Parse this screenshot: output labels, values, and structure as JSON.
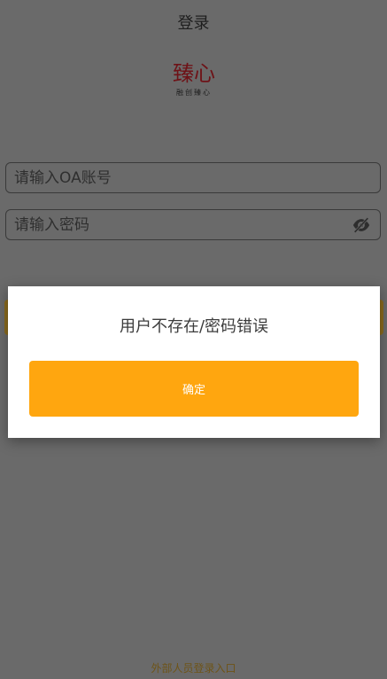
{
  "header": {
    "title": "登录"
  },
  "logo": {
    "main_text": "臻心",
    "sub_text": "融创臻心"
  },
  "form": {
    "account_placeholder": "请输入OA账号",
    "password_placeholder": "请输入密码",
    "password_toggle_icon": "eye-slash-icon"
  },
  "footer": {
    "external_login_label": "外部人员登录入口"
  },
  "dialog": {
    "message": "用户不存在/密码错误",
    "confirm_label": "确定"
  },
  "colors": {
    "accent": "#ffa60f",
    "overlay_background": "#6a6a6a",
    "brand": "#6e1217"
  }
}
